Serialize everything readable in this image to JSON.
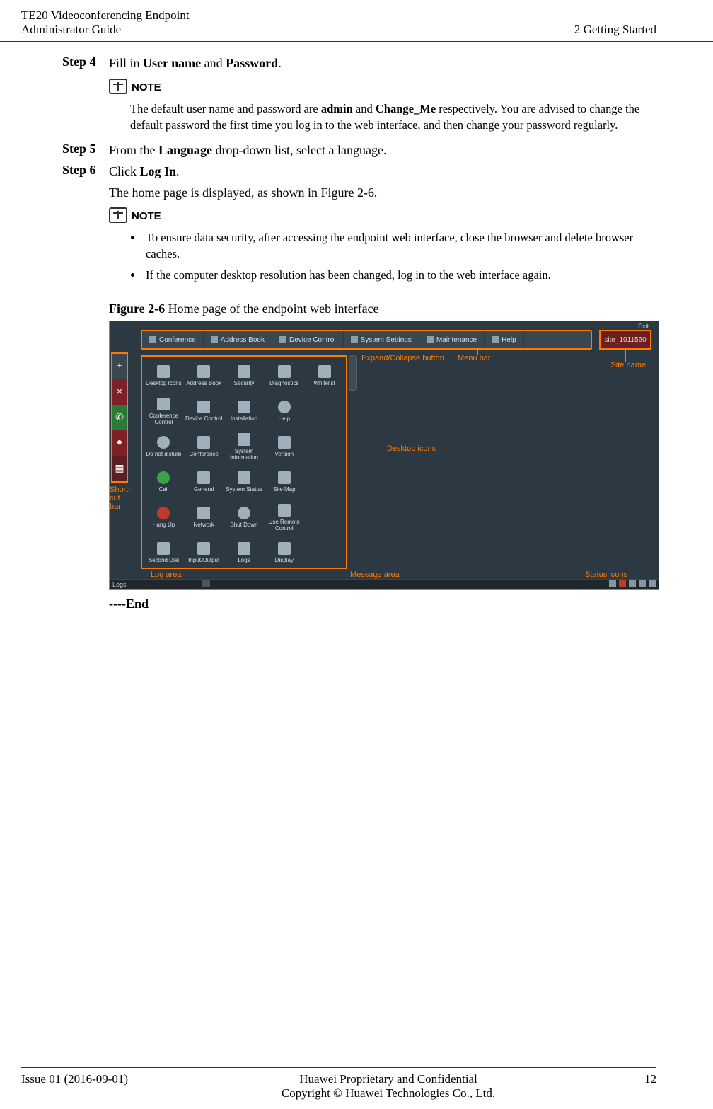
{
  "header": {
    "product": "TE20 Videoconferencing Endpoint",
    "doc": "Administrator Guide",
    "section": "2 Getting Started"
  },
  "steps": {
    "s4_label": "Step 4",
    "s4_pre": "Fill in ",
    "s4_b1": "User name",
    "s4_mid": " and ",
    "s4_b2": "Password",
    "s4_post": ".",
    "s5_label": "Step 5",
    "s5_pre": "From the ",
    "s5_b": "Language",
    "s5_post": " drop-down list, select a language.",
    "s6_label": "Step 6",
    "s6_pre": "Click ",
    "s6_b": "Log In",
    "s6_post": "."
  },
  "note1": {
    "label": "NOTE",
    "text_pre": "The default user name and password are ",
    "b1": "admin",
    "mid": " and ",
    "b2": "Change_Me",
    "text_post": " respectively. You are advised to change the default password the first time you log in to the web interface, and then change your password regularly."
  },
  "home_para": "The home page is displayed, as shown in Figure 2-6.",
  "note2": {
    "label": "NOTE",
    "b1": "To ensure data security, after accessing the endpoint web interface, close the browser and delete browser caches.",
    "b2": "If the computer desktop resolution has been changed, log in to the web interface again."
  },
  "figure": {
    "caption_b": "Figure 2-6",
    "caption_rest": " Home page of the endpoint web interface",
    "menubar": [
      "Conference",
      "Address Book",
      "Device Control",
      "System Settings",
      "Maintenance",
      "Help"
    ],
    "site_name": "site_1011560",
    "exit": "Exit",
    "annot_expand": "Expand/Collapse button",
    "annot_menu": "Menu bar",
    "annot_site": "Site name",
    "annot_desktop": "Desktop icons",
    "annot_shortcut": "Short-cut bar",
    "annot_log": "Log area",
    "annot_msg": "Message area",
    "annot_status": "Status icons",
    "icons": [
      "Desktop Icons",
      "Address Book",
      "Security",
      "Diagnostics",
      "Whitelist",
      "Conference Control",
      "Device Control",
      "Installation",
      "Help",
      "",
      "Do not disturb",
      "Conference",
      "System Information",
      "Version",
      "",
      "Call",
      "General",
      "System Status",
      "Site Map",
      "",
      "Hang Up",
      "Network",
      "Shut Down",
      "Use Remote Control",
      "",
      "Second Dial",
      "Input/Output",
      "Logs",
      "Display",
      ""
    ],
    "logs_label": "Logs"
  },
  "end": "----End",
  "footer": {
    "issue": "Issue 01 (2016-09-01)",
    "line1": "Huawei Proprietary and Confidential",
    "line2": "Copyright © Huawei Technologies Co., Ltd.",
    "page": "12"
  }
}
